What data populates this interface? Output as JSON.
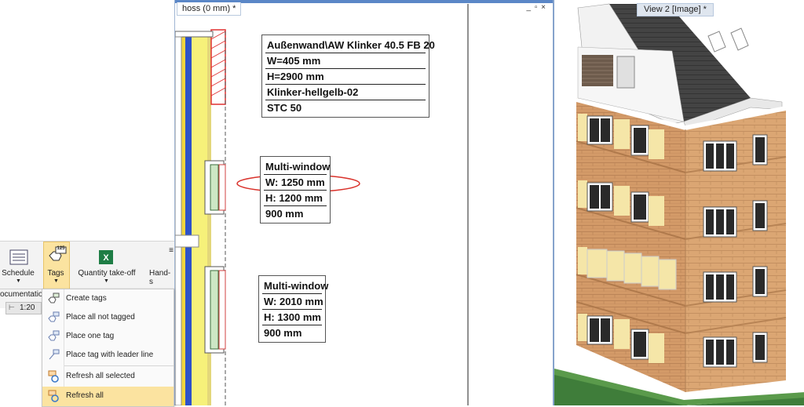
{
  "plan_view": {
    "tab_title": "hoss (0 mm) *",
    "window_controls": "_ ▫ ×"
  },
  "view2": {
    "tab_title": "View 2 [Image] *"
  },
  "wall_tag": {
    "rows": [
      "Außenwand\\AW Klinker 40.5 FB 20",
      "W=405 mm",
      "H=2900 mm",
      "Klinker-hellgelb-02",
      "STC 50"
    ]
  },
  "window_tag_1": {
    "rows": [
      "Multi-window",
      "W: 1250 mm",
      "H: 1200 mm",
      "900 mm"
    ]
  },
  "window_tag_2": {
    "rows": [
      "Multi-window",
      "W: 2010 mm",
      "H: 1300 mm",
      "900 mm"
    ]
  },
  "ribbon": {
    "schedule": "Schedule",
    "tags": "Tags",
    "quantity": "Quantity take-off",
    "hand": "Hand-s",
    "documentation": "ocumentation",
    "scale": "1:20",
    "tags_icon_text": "125"
  },
  "tags_menu": {
    "items": [
      "Create tags",
      "Place all not tagged",
      "Place one tag",
      "Place tag with leader line",
      "Refresh all selected",
      "Refresh all"
    ]
  },
  "colors": {
    "accent": "#5b87c7",
    "highlight_oval": "#d9322b",
    "menu_selected": "#fbe3a0"
  }
}
